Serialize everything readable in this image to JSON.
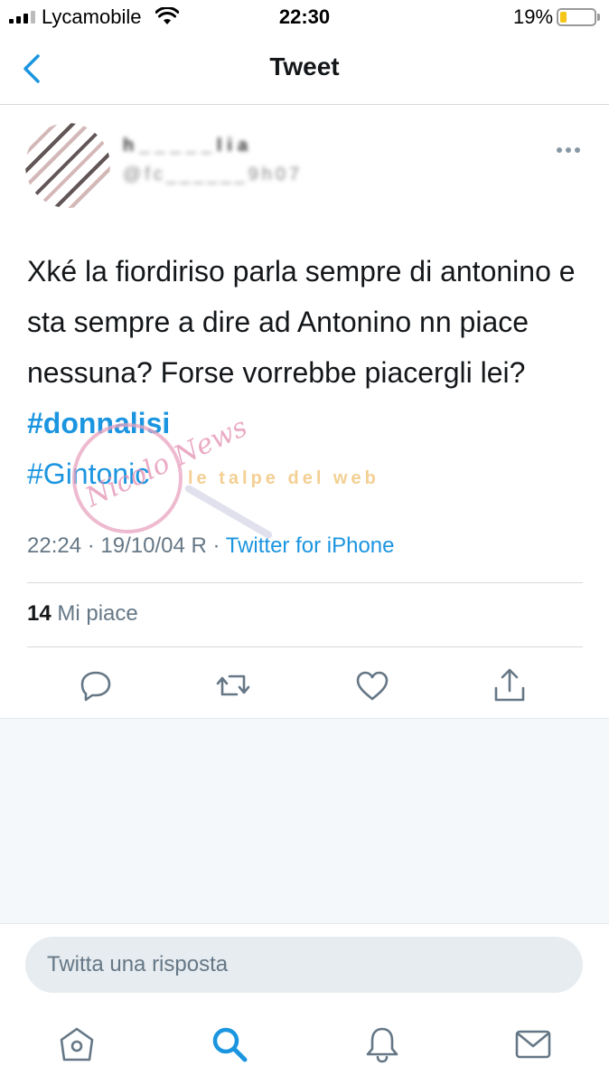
{
  "status_bar": {
    "carrier": "Lycamobile",
    "time": "22:30",
    "battery_percent_label": "19%",
    "battery_level": 0.19,
    "battery_color": "#f5c518"
  },
  "nav": {
    "title": "Tweet",
    "back_icon": "chevron-left-icon"
  },
  "tweet": {
    "author_name": "h_____lia",
    "author_handle": "@fc______9h07",
    "text_segments": [
      {
        "text": "Xké la fiordiriso parla sempre di antonino e sta sempre a dire ad Antonino nn piace nessuna? Forse vorrebbe piacergli lei? "
      },
      {
        "text": "#donnalisi",
        "type": "hashtag-bold"
      },
      {
        "text": "#Gintonic",
        "type": "hashtag"
      }
    ],
    "time": "22:24",
    "date": "19/10/04",
    "retweet_marker": "R",
    "source": "Twitter for iPhone",
    "likes_count": "14",
    "likes_label": "Mi piace"
  },
  "watermark": {
    "text": "Nicolo News",
    "subtext": "le talpe del web"
  },
  "actions": [
    {
      "name": "reply-icon"
    },
    {
      "name": "retweet-icon"
    },
    {
      "name": "like-icon"
    },
    {
      "name": "share-icon"
    }
  ],
  "reply": {
    "placeholder": "Twitta una risposta"
  },
  "tab_bar": [
    {
      "name": "home-icon",
      "active": false
    },
    {
      "name": "search-icon",
      "active": true
    },
    {
      "name": "notifications-icon",
      "active": false
    },
    {
      "name": "messages-icon",
      "active": false
    }
  ],
  "colors": {
    "accent": "#1b95e0",
    "icon_gray": "#657786",
    "text": "#14171a"
  }
}
